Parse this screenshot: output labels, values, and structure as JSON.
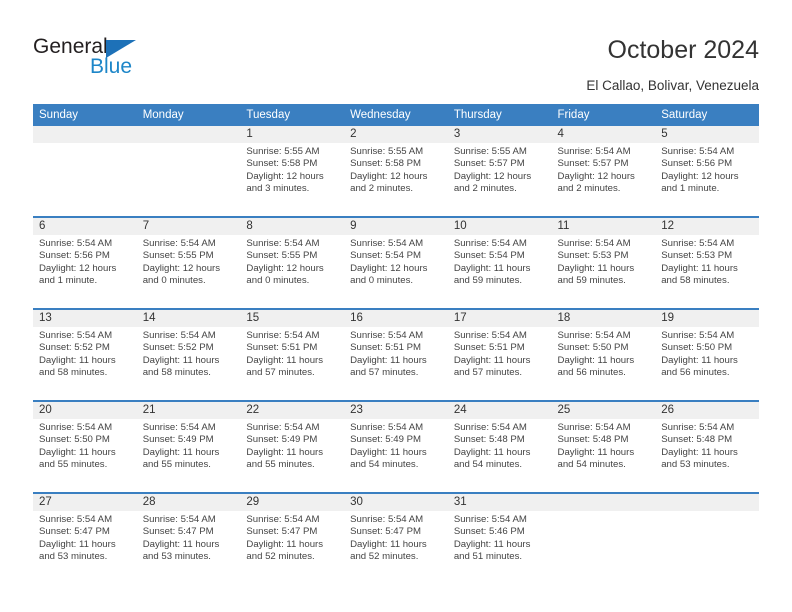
{
  "brand": {
    "name_part1": "General",
    "name_part2": "Blue",
    "accent_color": "#1d86c8",
    "triangle_color": "#1d71b8"
  },
  "header": {
    "title": "October 2024",
    "location": "El Callao, Bolivar, Venezuela"
  },
  "calendar": {
    "header_bg": "#3a7fc1",
    "daynum_bg": "#f0f0f0",
    "weekday_headers": [
      "Sunday",
      "Monday",
      "Tuesday",
      "Wednesday",
      "Thursday",
      "Friday",
      "Saturday"
    ],
    "weeks": [
      [
        {
          "day": "",
          "lines": []
        },
        {
          "day": "",
          "lines": []
        },
        {
          "day": "1",
          "lines": [
            "Sunrise: 5:55 AM",
            "Sunset: 5:58 PM",
            "Daylight: 12 hours",
            "and 3 minutes."
          ]
        },
        {
          "day": "2",
          "lines": [
            "Sunrise: 5:55 AM",
            "Sunset: 5:58 PM",
            "Daylight: 12 hours",
            "and 2 minutes."
          ]
        },
        {
          "day": "3",
          "lines": [
            "Sunrise: 5:55 AM",
            "Sunset: 5:57 PM",
            "Daylight: 12 hours",
            "and 2 minutes."
          ]
        },
        {
          "day": "4",
          "lines": [
            "Sunrise: 5:54 AM",
            "Sunset: 5:57 PM",
            "Daylight: 12 hours",
            "and 2 minutes."
          ]
        },
        {
          "day": "5",
          "lines": [
            "Sunrise: 5:54 AM",
            "Sunset: 5:56 PM",
            "Daylight: 12 hours",
            "and 1 minute."
          ]
        }
      ],
      [
        {
          "day": "6",
          "lines": [
            "Sunrise: 5:54 AM",
            "Sunset: 5:56 PM",
            "Daylight: 12 hours",
            "and 1 minute."
          ]
        },
        {
          "day": "7",
          "lines": [
            "Sunrise: 5:54 AM",
            "Sunset: 5:55 PM",
            "Daylight: 12 hours",
            "and 0 minutes."
          ]
        },
        {
          "day": "8",
          "lines": [
            "Sunrise: 5:54 AM",
            "Sunset: 5:55 PM",
            "Daylight: 12 hours",
            "and 0 minutes."
          ]
        },
        {
          "day": "9",
          "lines": [
            "Sunrise: 5:54 AM",
            "Sunset: 5:54 PM",
            "Daylight: 12 hours",
            "and 0 minutes."
          ]
        },
        {
          "day": "10",
          "lines": [
            "Sunrise: 5:54 AM",
            "Sunset: 5:54 PM",
            "Daylight: 11 hours",
            "and 59 minutes."
          ]
        },
        {
          "day": "11",
          "lines": [
            "Sunrise: 5:54 AM",
            "Sunset: 5:53 PM",
            "Daylight: 11 hours",
            "and 59 minutes."
          ]
        },
        {
          "day": "12",
          "lines": [
            "Sunrise: 5:54 AM",
            "Sunset: 5:53 PM",
            "Daylight: 11 hours",
            "and 58 minutes."
          ]
        }
      ],
      [
        {
          "day": "13",
          "lines": [
            "Sunrise: 5:54 AM",
            "Sunset: 5:52 PM",
            "Daylight: 11 hours",
            "and 58 minutes."
          ]
        },
        {
          "day": "14",
          "lines": [
            "Sunrise: 5:54 AM",
            "Sunset: 5:52 PM",
            "Daylight: 11 hours",
            "and 58 minutes."
          ]
        },
        {
          "day": "15",
          "lines": [
            "Sunrise: 5:54 AM",
            "Sunset: 5:51 PM",
            "Daylight: 11 hours",
            "and 57 minutes."
          ]
        },
        {
          "day": "16",
          "lines": [
            "Sunrise: 5:54 AM",
            "Sunset: 5:51 PM",
            "Daylight: 11 hours",
            "and 57 minutes."
          ]
        },
        {
          "day": "17",
          "lines": [
            "Sunrise: 5:54 AM",
            "Sunset: 5:51 PM",
            "Daylight: 11 hours",
            "and 57 minutes."
          ]
        },
        {
          "day": "18",
          "lines": [
            "Sunrise: 5:54 AM",
            "Sunset: 5:50 PM",
            "Daylight: 11 hours",
            "and 56 minutes."
          ]
        },
        {
          "day": "19",
          "lines": [
            "Sunrise: 5:54 AM",
            "Sunset: 5:50 PM",
            "Daylight: 11 hours",
            "and 56 minutes."
          ]
        }
      ],
      [
        {
          "day": "20",
          "lines": [
            "Sunrise: 5:54 AM",
            "Sunset: 5:50 PM",
            "Daylight: 11 hours",
            "and 55 minutes."
          ]
        },
        {
          "day": "21",
          "lines": [
            "Sunrise: 5:54 AM",
            "Sunset: 5:49 PM",
            "Daylight: 11 hours",
            "and 55 minutes."
          ]
        },
        {
          "day": "22",
          "lines": [
            "Sunrise: 5:54 AM",
            "Sunset: 5:49 PM",
            "Daylight: 11 hours",
            "and 55 minutes."
          ]
        },
        {
          "day": "23",
          "lines": [
            "Sunrise: 5:54 AM",
            "Sunset: 5:49 PM",
            "Daylight: 11 hours",
            "and 54 minutes."
          ]
        },
        {
          "day": "24",
          "lines": [
            "Sunrise: 5:54 AM",
            "Sunset: 5:48 PM",
            "Daylight: 11 hours",
            "and 54 minutes."
          ]
        },
        {
          "day": "25",
          "lines": [
            "Sunrise: 5:54 AM",
            "Sunset: 5:48 PM",
            "Daylight: 11 hours",
            "and 54 minutes."
          ]
        },
        {
          "day": "26",
          "lines": [
            "Sunrise: 5:54 AM",
            "Sunset: 5:48 PM",
            "Daylight: 11 hours",
            "and 53 minutes."
          ]
        }
      ],
      [
        {
          "day": "27",
          "lines": [
            "Sunrise: 5:54 AM",
            "Sunset: 5:47 PM",
            "Daylight: 11 hours",
            "and 53 minutes."
          ]
        },
        {
          "day": "28",
          "lines": [
            "Sunrise: 5:54 AM",
            "Sunset: 5:47 PM",
            "Daylight: 11 hours",
            "and 53 minutes."
          ]
        },
        {
          "day": "29",
          "lines": [
            "Sunrise: 5:54 AM",
            "Sunset: 5:47 PM",
            "Daylight: 11 hours",
            "and 52 minutes."
          ]
        },
        {
          "day": "30",
          "lines": [
            "Sunrise: 5:54 AM",
            "Sunset: 5:47 PM",
            "Daylight: 11 hours",
            "and 52 minutes."
          ]
        },
        {
          "day": "31",
          "lines": [
            "Sunrise: 5:54 AM",
            "Sunset: 5:46 PM",
            "Daylight: 11 hours",
            "and 51 minutes."
          ]
        },
        {
          "day": "",
          "lines": []
        },
        {
          "day": "",
          "lines": []
        }
      ]
    ]
  }
}
